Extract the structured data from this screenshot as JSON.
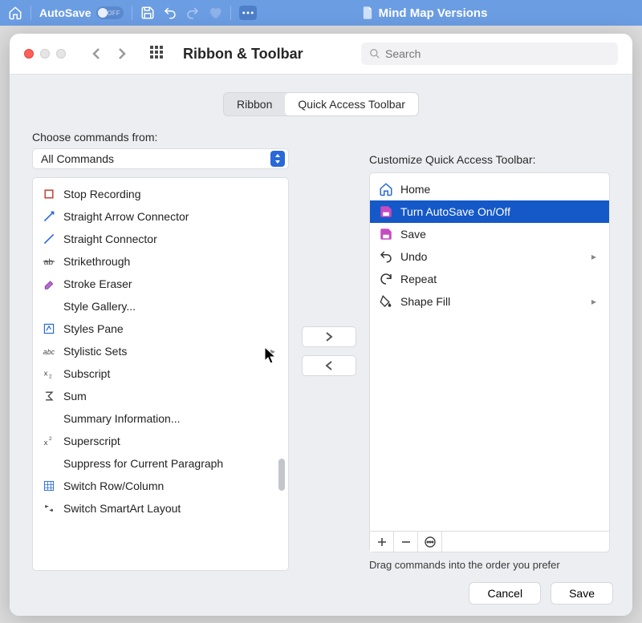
{
  "titlebar": {
    "autosave_label": "AutoSave",
    "autosave_toggle": "OFF",
    "document_title": "Mind Map Versions"
  },
  "sheet": {
    "title": "Ribbon & Toolbar",
    "search_placeholder": "Search",
    "tabs": {
      "ribbon": "Ribbon",
      "qat": "Quick Access Toolbar",
      "active": "qat"
    }
  },
  "left": {
    "label": "Choose commands from:",
    "combo_value": "All Commands",
    "items": [
      {
        "label": "Stop Recording"
      },
      {
        "label": "Straight Arrow Connector"
      },
      {
        "label": "Straight Connector"
      },
      {
        "label": "Strikethrough"
      },
      {
        "label": "Stroke Eraser"
      },
      {
        "label": "Style Gallery..."
      },
      {
        "label": "Styles Pane"
      },
      {
        "label": "Stylistic Sets",
        "submenu": true
      },
      {
        "label": "Subscript"
      },
      {
        "label": "Sum"
      },
      {
        "label": "Summary Information..."
      },
      {
        "label": "Superscript"
      },
      {
        "label": "Suppress for Current Paragraph"
      },
      {
        "label": "Switch Row/Column"
      },
      {
        "label": "Switch SmartArt Layout"
      }
    ]
  },
  "right": {
    "label": "Customize Quick Access Toolbar:",
    "items": [
      {
        "label": "Home"
      },
      {
        "label": "Turn AutoSave On/Off",
        "selected": true
      },
      {
        "label": "Save"
      },
      {
        "label": "Undo",
        "submenu": true
      },
      {
        "label": "Repeat"
      },
      {
        "label": "Shape Fill",
        "submenu": true
      }
    ],
    "hint": "Drag commands into the order you prefer"
  },
  "footer": {
    "cancel": "Cancel",
    "save": "Save"
  }
}
